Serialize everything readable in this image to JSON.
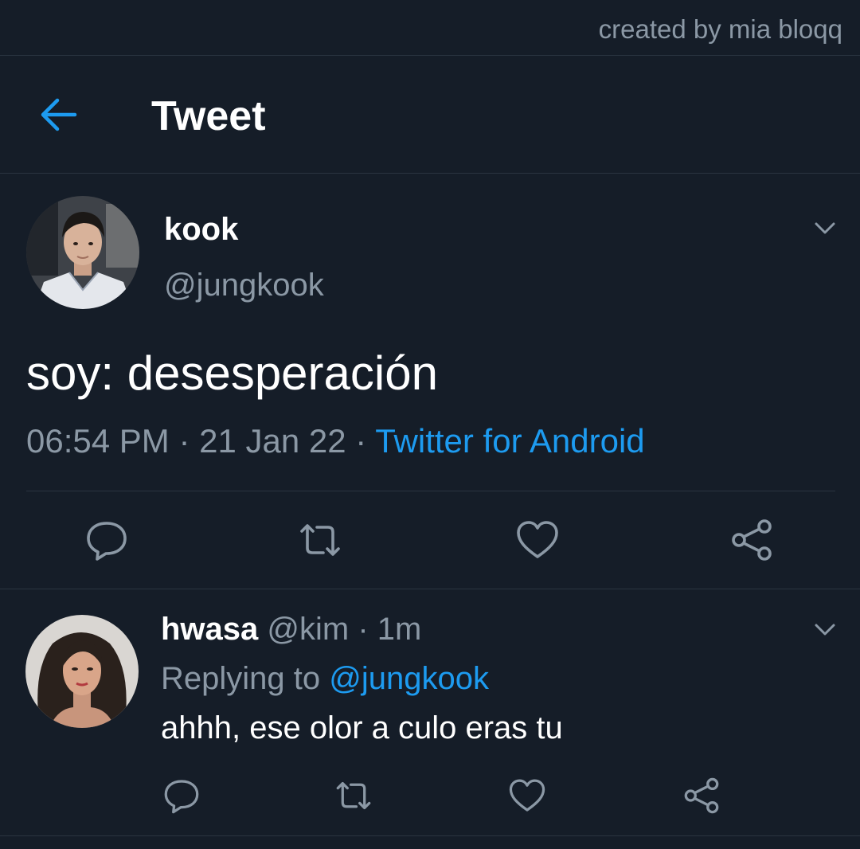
{
  "watermark": "created by mia bloqq",
  "header": {
    "title": "Tweet",
    "back_icon": "arrow-left-icon"
  },
  "colors": {
    "background": "#151d28",
    "accent": "#1d9bf0",
    "muted": "#8b98a5",
    "divider": "#2a3440"
  },
  "tweet": {
    "display_name": "kook",
    "handle": "@jungkook",
    "text": "soy: desesperación",
    "time": "06:54 PM",
    "sep1": " · ",
    "date": "21 Jan 22",
    "sep2": " · ",
    "source": "Twitter for Android",
    "actions": [
      "reply-icon",
      "retweet-icon",
      "like-icon",
      "share-icon"
    ]
  },
  "reply": {
    "display_name": "hwasa",
    "handle": "@kim",
    "sep": " · ",
    "age": "1m",
    "replying_prefix": "Replying to ",
    "replying_to": "@jungkook",
    "text": "ahhh, ese olor a culo eras tu",
    "actions": [
      "reply-icon",
      "retweet-icon",
      "like-icon",
      "share-icon"
    ]
  }
}
